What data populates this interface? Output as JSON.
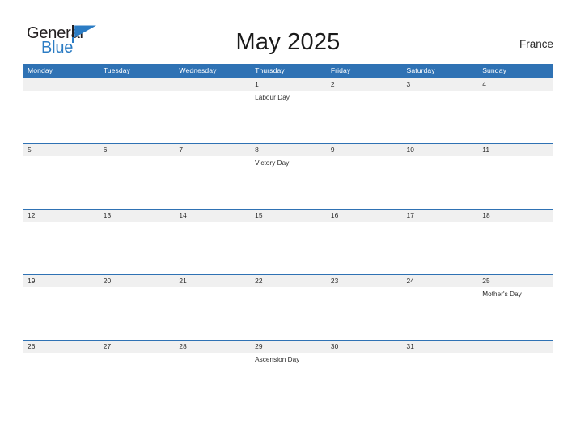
{
  "brand": {
    "name_top": "General",
    "name_bottom": "Blue",
    "mark_icon": "flag-triangle-icon",
    "color_top": "#231f20",
    "color_bottom": "#2b7cc4"
  },
  "header": {
    "title": "May 2025",
    "country": "France"
  },
  "calendar": {
    "header_color": "#2f72b4",
    "band_color": "#f0f0f0",
    "weekdays": [
      "Monday",
      "Tuesday",
      "Wednesday",
      "Thursday",
      "Friday",
      "Saturday",
      "Sunday"
    ],
    "weeks": [
      {
        "days": [
          {
            "date": "",
            "event": ""
          },
          {
            "date": "",
            "event": ""
          },
          {
            "date": "",
            "event": ""
          },
          {
            "date": "1",
            "event": "Labour Day"
          },
          {
            "date": "2",
            "event": ""
          },
          {
            "date": "3",
            "event": ""
          },
          {
            "date": "4",
            "event": ""
          }
        ]
      },
      {
        "days": [
          {
            "date": "5",
            "event": ""
          },
          {
            "date": "6",
            "event": ""
          },
          {
            "date": "7",
            "event": ""
          },
          {
            "date": "8",
            "event": "Victory Day"
          },
          {
            "date": "9",
            "event": ""
          },
          {
            "date": "10",
            "event": ""
          },
          {
            "date": "11",
            "event": ""
          }
        ]
      },
      {
        "days": [
          {
            "date": "12",
            "event": ""
          },
          {
            "date": "13",
            "event": ""
          },
          {
            "date": "14",
            "event": ""
          },
          {
            "date": "15",
            "event": ""
          },
          {
            "date": "16",
            "event": ""
          },
          {
            "date": "17",
            "event": ""
          },
          {
            "date": "18",
            "event": ""
          }
        ]
      },
      {
        "days": [
          {
            "date": "19",
            "event": ""
          },
          {
            "date": "20",
            "event": ""
          },
          {
            "date": "21",
            "event": ""
          },
          {
            "date": "22",
            "event": ""
          },
          {
            "date": "23",
            "event": ""
          },
          {
            "date": "24",
            "event": ""
          },
          {
            "date": "25",
            "event": "Mother's Day"
          }
        ]
      },
      {
        "days": [
          {
            "date": "26",
            "event": ""
          },
          {
            "date": "27",
            "event": ""
          },
          {
            "date": "28",
            "event": ""
          },
          {
            "date": "29",
            "event": "Ascension Day"
          },
          {
            "date": "30",
            "event": ""
          },
          {
            "date": "31",
            "event": ""
          },
          {
            "date": "",
            "event": ""
          }
        ]
      }
    ]
  }
}
